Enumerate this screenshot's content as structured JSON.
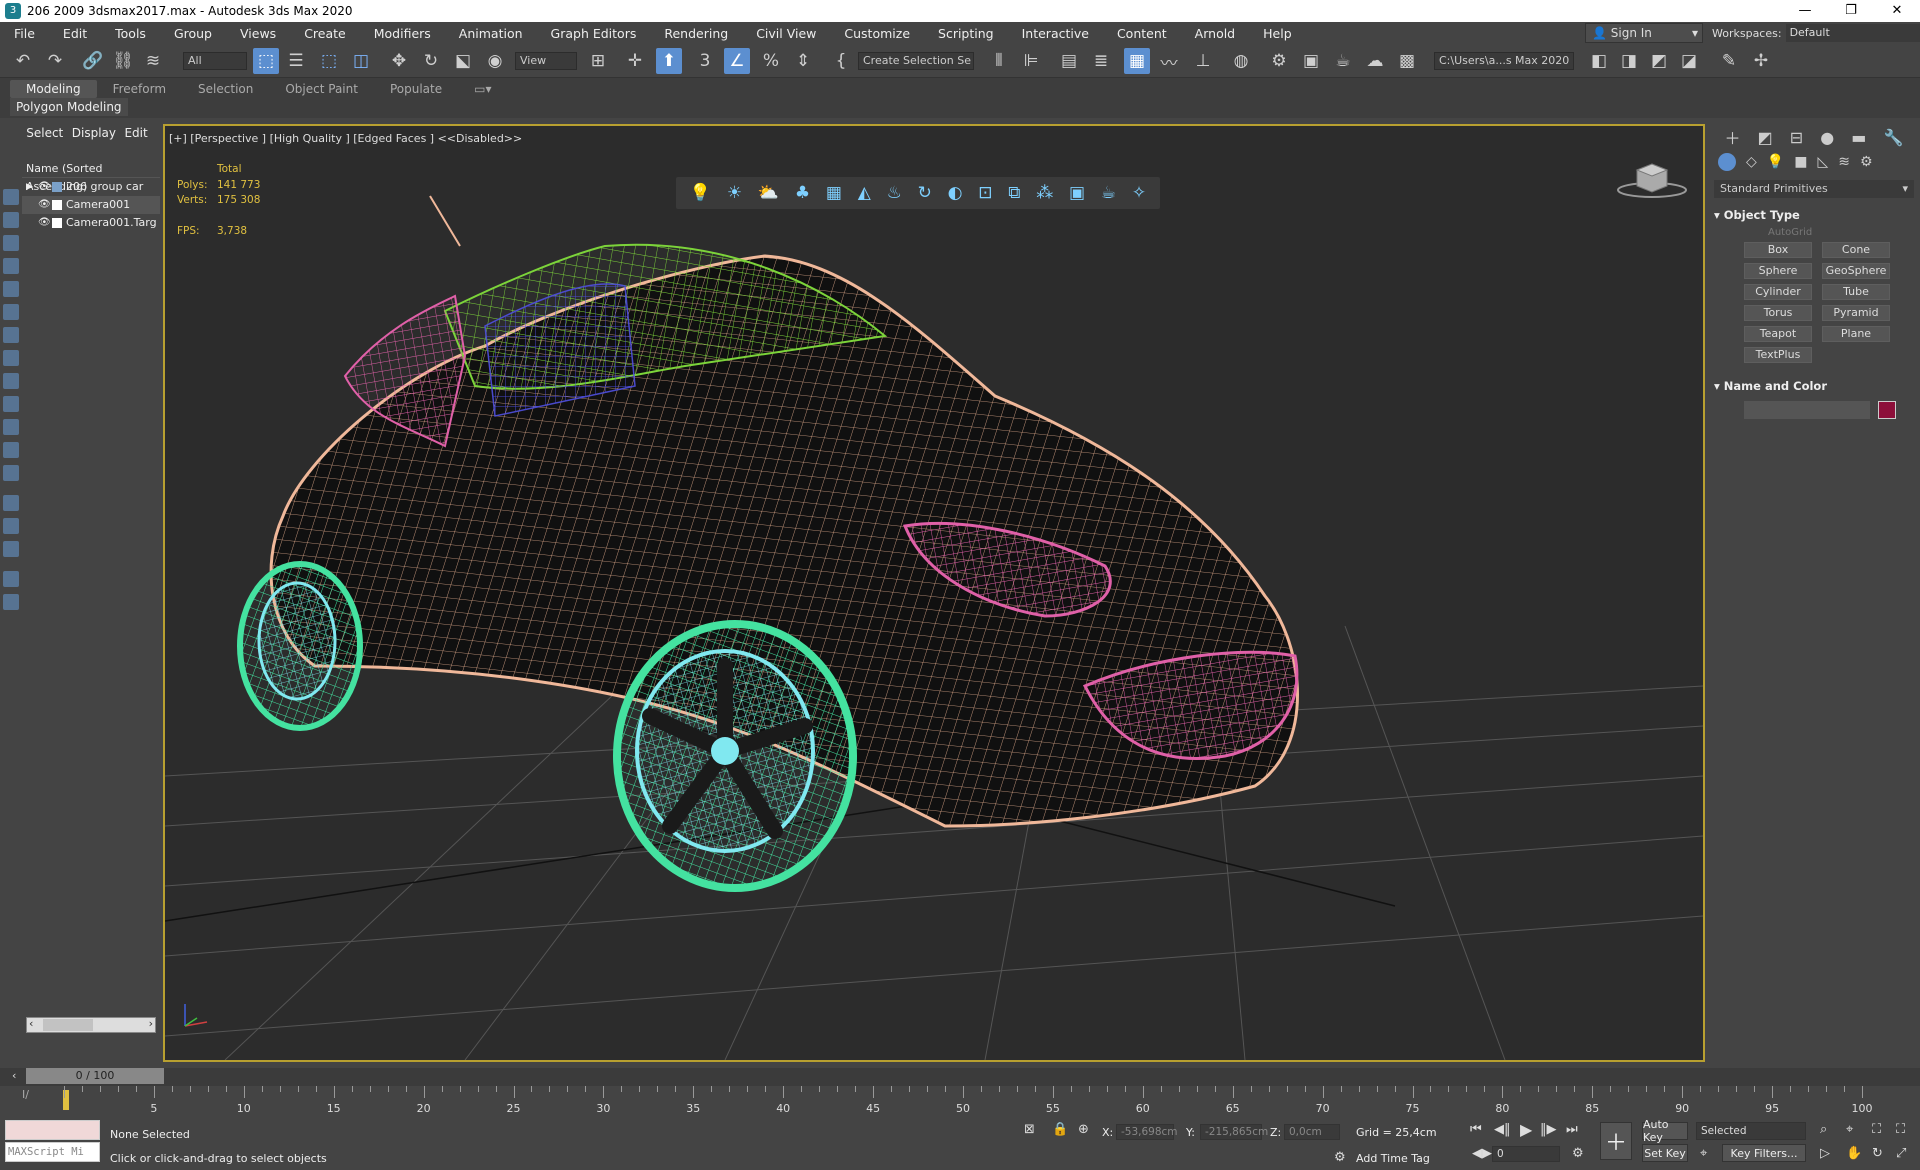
{
  "window": {
    "title": "206 2009 3dsmax2017.max - Autodesk 3ds Max 2020",
    "controls": [
      "—",
      "❐",
      "✕"
    ]
  },
  "menu": {
    "items": [
      "File",
      "Edit",
      "Tools",
      "Group",
      "Views",
      "Create",
      "Modifiers",
      "Animation",
      "Graph Editors",
      "Rendering",
      "Civil View",
      "Customize",
      "Scripting",
      "Interactive",
      "Content",
      "Arnold",
      "Help"
    ],
    "sign_in": "Sign In",
    "workspaces_label": "Workspaces:",
    "workspace_value": "Default"
  },
  "toolbar": {
    "selection_filter": "All",
    "ref_coord": "View",
    "named_selection": "Create Selection Se",
    "project_path": "C:\\Users\\a...s Max 2020"
  },
  "ribbon": {
    "tabs": [
      "Modeling",
      "Freeform",
      "Selection",
      "Object Paint",
      "Populate"
    ],
    "active_tab": "Modeling",
    "subtab": "Polygon Modeling"
  },
  "scene_explorer": {
    "tabs": [
      "Select",
      "Display",
      "Edit"
    ],
    "header": "Name (Sorted Ascending)",
    "rows": [
      "206 group car",
      "Camera001",
      "Camera001.Targ"
    ]
  },
  "viewport": {
    "label": "[+] [Perspective ] [High Quality ] [Edged Faces ]  <<Disabled>>",
    "stats": {
      "total_label": "Total",
      "polys_label": "Polys:",
      "polys_value": "141 773",
      "verts_label": "Verts:",
      "verts_value": "175 308",
      "fps_label": "FPS:",
      "fps_value": "3,738"
    }
  },
  "command_panel": {
    "category": "Standard Primitives",
    "object_type_title": "Object Type",
    "autogrid": "AutoGrid",
    "primitives": [
      "Box",
      "Cone",
      "Sphere",
      "GeoSphere",
      "Cylinder",
      "Tube",
      "Torus",
      "Pyramid",
      "Teapot",
      "Plane",
      "TextPlus"
    ],
    "name_color_title": "Name and Color",
    "color": "#8d0f3a"
  },
  "timeline": {
    "frame_display": "0 / 100",
    "tick_labels": [
      "5",
      "10",
      "15",
      "20",
      "25",
      "30",
      "35",
      "40",
      "45",
      "50",
      "55",
      "60",
      "65",
      "70",
      "75",
      "80",
      "85",
      "90",
      "95",
      "100"
    ]
  },
  "status": {
    "selection": "None Selected",
    "prompt": "Click or click-and-drag to select objects",
    "maxscript": "MAXScript Mi",
    "x_label": "X:",
    "x_value": "-53,698cm",
    "y_label": "Y:",
    "y_value": "-215,865cm",
    "z_label": "Z:",
    "z_value": "0,0cm",
    "grid": "Grid = 25,4cm",
    "add_time_tag": "Add Time Tag",
    "auto_key": "Auto Key",
    "set_key": "Set Key",
    "key_mode": "Selected",
    "key_filters": "Key Filters...",
    "current_frame": "0"
  }
}
